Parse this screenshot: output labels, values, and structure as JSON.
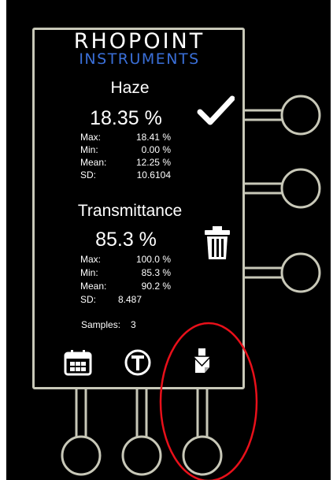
{
  "brand": {
    "line1": "RHOPOINT",
    "line2": "INSTRUMENTS"
  },
  "haze": {
    "title": "Haze",
    "value": "18.35 %",
    "stats": [
      {
        "label": "Max:",
        "value": "18.41 %"
      },
      {
        "label": "Min:",
        "value": "0.00 %"
      },
      {
        "label": "Mean:",
        "value": "12.25 %"
      },
      {
        "label": "SD:",
        "value": "10.6104"
      }
    ]
  },
  "transmittance": {
    "title": "Transmittance",
    "value": "85.3 %",
    "stats": [
      {
        "label": "Max:",
        "value": "100.0 %"
      },
      {
        "label": "Min:",
        "value": "85.3 %"
      },
      {
        "label": "Mean:",
        "value": "90.2 %"
      },
      {
        "label": "SD:",
        "value": "8.487"
      }
    ]
  },
  "samples": {
    "label": "Samples:",
    "count": "3"
  },
  "icons": {
    "confirm": "checkmark-icon",
    "delete": "trash-icon",
    "calendar": "calendar-icon",
    "timer": "t-circle-icon",
    "download": "download-document-icon"
  },
  "colors": {
    "background": "#000000",
    "frame": "#c8c8b8",
    "brand_blue": "#3a6fd8",
    "annotation": "#e8101a"
  }
}
